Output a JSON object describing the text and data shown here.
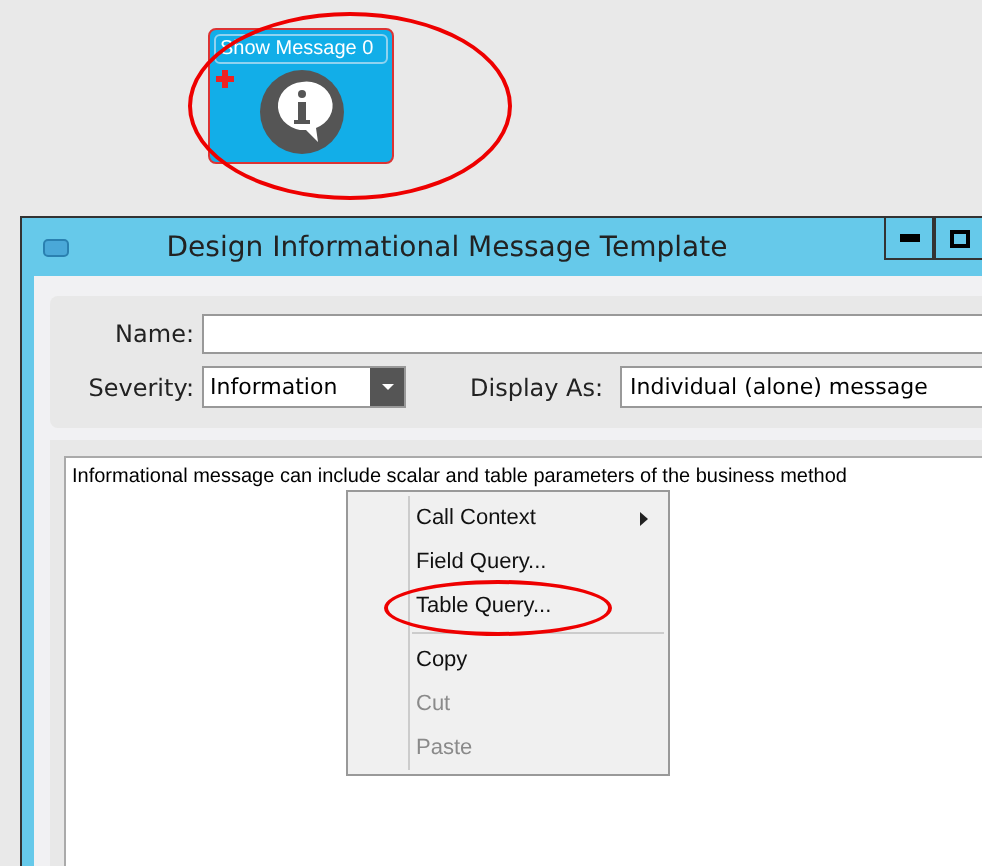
{
  "node": {
    "title": "Show Message 0",
    "annotated": true
  },
  "window": {
    "title": "Design Informational Message Template"
  },
  "form": {
    "name": {
      "label": "Name:"
    },
    "severity": {
      "label": "Severity:",
      "value": "Information"
    },
    "display_as": {
      "label": "Display As:",
      "value": "Individual (alone) message"
    }
  },
  "editor": {
    "text": "Informational message can include scalar and table parameters of the business method"
  },
  "context_menu": {
    "items": [
      {
        "kind": "submenu",
        "label": "Call Context",
        "disabled": false,
        "annotated": false
      },
      {
        "kind": "command",
        "label": "Field Query...",
        "disabled": false,
        "annotated": false
      },
      {
        "kind": "command",
        "label": "Table Query...",
        "disabled": false,
        "annotated": true
      },
      {
        "kind": "separator"
      },
      {
        "kind": "command",
        "label": "Copy",
        "disabled": false,
        "annotated": false
      },
      {
        "kind": "command",
        "label": "Cut",
        "disabled": true,
        "annotated": false
      },
      {
        "kind": "command",
        "label": "Paste",
        "disabled": true,
        "annotated": false
      }
    ]
  }
}
